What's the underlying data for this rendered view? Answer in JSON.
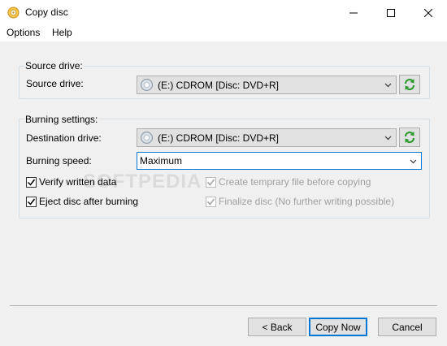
{
  "window": {
    "title": "Copy disc",
    "icons": {
      "app": "disc-icon",
      "minimize": "minimize-icon",
      "maximize": "maximize-icon",
      "close": "close-icon"
    }
  },
  "menu": {
    "items": [
      "Options",
      "Help"
    ]
  },
  "source": {
    "group_label": "Source drive:",
    "label": "Source drive:",
    "drive_value": "(E:) CDROM [Disc: DVD+R]"
  },
  "burning": {
    "group_label": "Burning settings:",
    "destination_label": "Destination drive:",
    "destination_value": "(E:) CDROM [Disc: DVD+R]",
    "speed_label": "Burning speed:",
    "speed_value": "Maximum",
    "options": {
      "verify": {
        "label": "Verify written data",
        "checked": true,
        "enabled": true
      },
      "eject": {
        "label": "Eject disc after burning",
        "checked": true,
        "enabled": true
      },
      "temp_file": {
        "label": "Create temprary file before copying",
        "checked": true,
        "enabled": false
      },
      "finalize": {
        "label": "Finalize disc (No further writing possible)",
        "checked": true,
        "enabled": false
      }
    }
  },
  "watermark": "SOFTPEDIA",
  "buttons": {
    "back": "< Back",
    "copy": "Copy Now",
    "cancel": "Cancel"
  },
  "colors": {
    "accent": "#0078d7",
    "refresh_green": "#2e9b2e"
  }
}
